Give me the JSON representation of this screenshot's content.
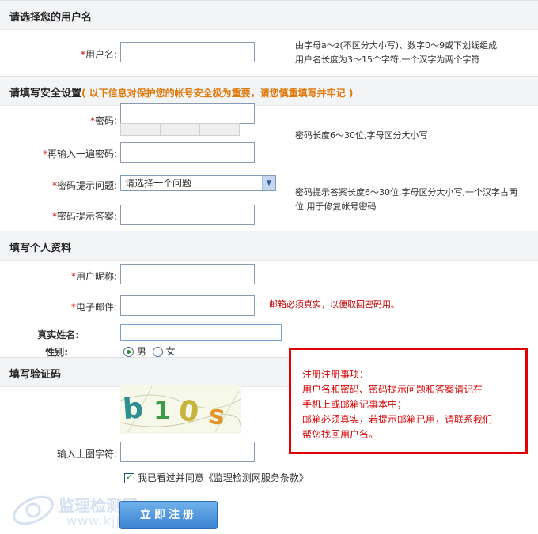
{
  "sections": {
    "username": {
      "title": "请选择您的用户名"
    },
    "security": {
      "title": "请填写安全设置",
      "note": "( 以下信息对保护您的帐号安全极为重要，请您慎重填写并牢记 )"
    },
    "profile": {
      "title": "填写个人资料"
    },
    "captcha": {
      "title": "填写验证码"
    }
  },
  "form": {
    "req": "*",
    "username_label": "用户名:",
    "username_hint_1": "由字母a～z(不区分大小写)、数字0～9或下划线组成",
    "username_hint_2": "用户名长度为3～15个字符,一个汉字为两个字符",
    "password_label": "密码:",
    "password_confirm_label": "再输入一遍密码:",
    "password_hint": "密码长度6～30位,字母区分大小写",
    "question_label": "密码提示问题:",
    "question_value": "请选择一个问题",
    "answer_label": "密码提示答案:",
    "answer_hint_1": "密码提示答案长度6～30位,字母区分大小写,一个汉字占两",
    "answer_hint_2": "位.用于修复帐号密码",
    "nickname_label": "用户昵称:",
    "email_label": "电子邮件:",
    "email_hint": "邮箱必须真实，以便取回密码用。",
    "realname_label": "真实姓名:",
    "gender_label": "性别:",
    "gender_male": "男",
    "gender_female": "女",
    "captcha_label": "输入上图字符:",
    "captcha_text": "b10s",
    "agree_text": "我已看过并同意《监理检测网服务条款》",
    "submit_label": "立即注册"
  },
  "notice": {
    "title": "注册注册事项：",
    "line1": "用户名和密码、密码提示问题和答案请记在",
    "line2": "手机上或邮箱记事本中；",
    "line3": "邮箱必须真实，若提示邮箱已用，请联系我们",
    "line4": "帮您找回用户名。"
  },
  "watermark": {
    "text": "监理检测网",
    "url": "www.kjjl.cn"
  },
  "colors": {
    "accent_red": "#d40000",
    "note_orange": "#e0780a",
    "button_blue": "#3c83d3"
  }
}
